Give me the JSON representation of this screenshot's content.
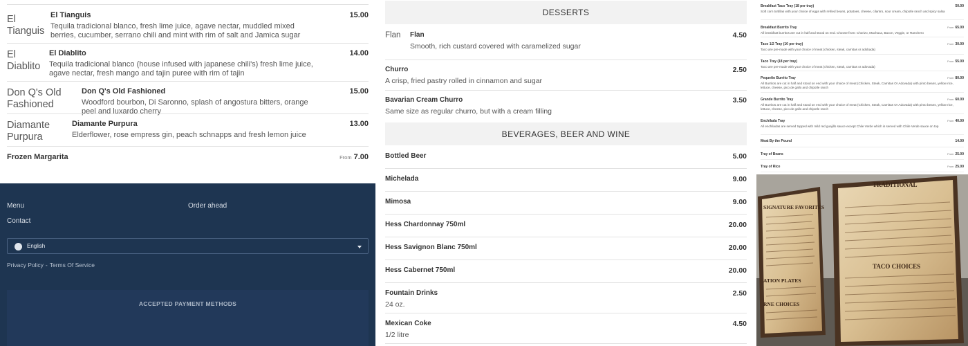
{
  "left_items": [
    {
      "img_alt": "El Tianguis",
      "name": "El Tianguis",
      "desc": "Tequila tradicional blanco, fresh lime juice, agave nectar, muddled mixed berries, cucumber, serrano chili and mint with rim of salt and Jamica sugar",
      "price": "15.00"
    },
    {
      "img_alt": "El Diablito",
      "name": "El Diablito",
      "desc": "Tequila tradicional blanco (house infused with japanese chili's) fresh lime juice, agave nectar, fresh mango and tajin puree with rim of tajin",
      "price": "14.00"
    },
    {
      "img_alt": "Don Q's Old Fashioned",
      "name": "Don Q's Old Fashioned",
      "desc": "Woodford bourbon, Di Saronno, splash of angostura bitters, orange peel and luxardo cherry",
      "price": "15.00"
    },
    {
      "img_alt": "Diamante Purpura",
      "name": "Diamante Purpura",
      "desc": "Elderflower, rose empress gin, peach schnapps and fresh lemon juice",
      "price": "13.00"
    },
    {
      "name": "Frozen Margarita",
      "from": "From",
      "price": "7.00"
    }
  ],
  "footer": {
    "menu_link": "Menu",
    "order_link": "Order ahead",
    "contact_link": "Contact",
    "language": "English",
    "privacy": "Privacy Policy",
    "separator": "-",
    "terms": "Terms Of Service",
    "payment_title": "ACCEPTED PAYMENT METHODS"
  },
  "desserts": {
    "title": "DESSERTS",
    "items": [
      {
        "img_alt": "Flan",
        "name": "Flan",
        "desc": "Smooth, rich custard covered with caramelized sugar",
        "price": "4.50"
      },
      {
        "name": "Churro",
        "desc": "A crisp, fried pastry rolled in cinnamon and sugar",
        "price": "2.50"
      },
      {
        "name": "Bavarian Cream Churro",
        "desc": "Same size as regular churro, but with a cream filling",
        "price": "3.50"
      }
    ]
  },
  "beverages": {
    "title": "BEVERAGES, BEER AND WINE",
    "items": [
      {
        "name": "Bottled Beer",
        "price": "5.00"
      },
      {
        "name": "Michelada",
        "price": "9.00"
      },
      {
        "name": "Mimosa",
        "price": "9.00"
      },
      {
        "name": "Hess Chardonnay 750ml",
        "price": "20.00"
      },
      {
        "name": "Hess Savignon Blanc 750ml",
        "price": "20.00"
      },
      {
        "name": "Hess Cabernet 750ml",
        "price": "20.00"
      },
      {
        "name": "Fountain Drinks",
        "desc": "24 oz.",
        "price": "2.50"
      },
      {
        "name": "Mexican Coke",
        "desc": "1/2 litre",
        "price": "4.50"
      }
    ]
  },
  "catering": [
    {
      "name": "Breakfast Taco Tray (18 per tray)",
      "desc": "Soft corn tortillas with your choice of eggs with refried beans, potatoes, cheese, cilantro, sour cream, chipotle ranch and spicy salsa",
      "price": "50.00"
    },
    {
      "name": "Breakfast Burrito Tray",
      "desc": "All breakfast burritos are cut in half and stood on end. Choose from: Chorizo, Machaca, Bacon, Veggie, or Ranchero",
      "from": "From",
      "price": "65.00"
    },
    {
      "name": "Taco 1/2 Tray (10 per tray)",
      "desc": "Taco are pre-made with your choice of meat (chicken, steak, carnitas or adobada)",
      "from": "From",
      "price": "30.00"
    },
    {
      "name": "Taco Tray (18 per tray)",
      "desc": "Taco are pre-made with your choice of meat (chicken, steak, carnitas or adovada)",
      "from": "From",
      "price": "55.00"
    },
    {
      "name": "Pequeño Burrito Tray",
      "desc": "All Burritos are cut in half and stood on end with your choice of meat (Chicken, Steak, Carnitas Or Adovada) with pinto beans, yellow rice, lettuce, cheese, pico de gallo and chipotle ranch",
      "from": "From",
      "price": "80.00"
    },
    {
      "name": "Grande Burrito Tray",
      "desc": "All Burritos are cut in half and stood on end with your choice of meat (Chicken, Steak, Carnitas Or Adovada) with pinto beans, yellow rice, lettuce, cheese, pico de gallo and chipotle ranch",
      "from": "From",
      "price": "60.00"
    },
    {
      "name": "Enchilada Tray",
      "desc": "All enchiladas are served topped with mild red guajillo sauce except Chile Verde which is served with Chile Verde sauce on top",
      "from": "From",
      "price": "40.00"
    },
    {
      "name": "Meat By the Pound",
      "price": "14.00"
    },
    {
      "name": "Tray of Beans",
      "from": "From",
      "price": "25.00"
    },
    {
      "name": "Tray of Rice",
      "from": "From",
      "price": "25.00"
    }
  ],
  "photo": {
    "alt": "Photo of printed menu boards",
    "board_text": [
      "TRADITIONAL",
      "SIGNATURE FAVORITES",
      "TACO CHOICES",
      "ATION PLATES",
      "RNE CHOICES"
    ]
  }
}
